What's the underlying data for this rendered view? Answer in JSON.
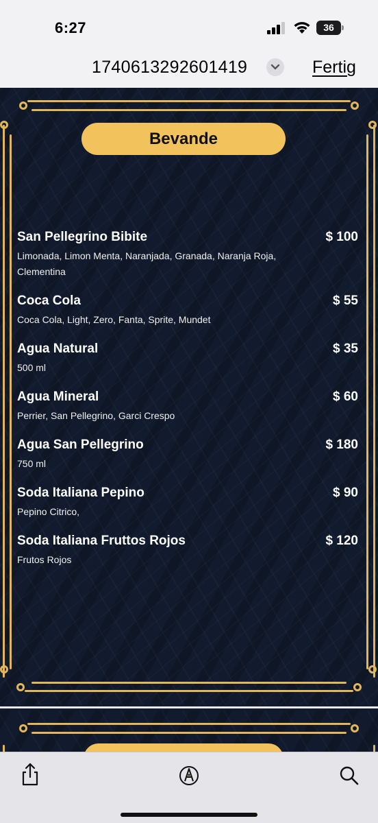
{
  "status_bar": {
    "time": "6:27",
    "battery": "36",
    "icons": [
      "signal-icon",
      "wifi-icon",
      "battery-icon"
    ]
  },
  "nav": {
    "title": "1740613292601419",
    "done_label": "Fertig"
  },
  "menu": {
    "section_title": "Bevande",
    "items": [
      {
        "name": "San Pellegrino Bibite",
        "price": "$ 100",
        "description": "Limonada, Limon Menta, Naranjada, Granada, Naranja Roja, Clementina"
      },
      {
        "name": "Coca Cola",
        "price": "$ 55",
        "description": "Coca Cola, Light, Zero, Fanta, Sprite, Mundet"
      },
      {
        "name": "Agua Natural",
        "price": "$ 35",
        "description": "500 ml"
      },
      {
        "name": "Agua Mineral",
        "price": "$ 60",
        "description": "Perrier, San Pellegrino, Garci Crespo"
      },
      {
        "name": "Agua San Pellegrino",
        "price": "$ 180",
        "description": "750 ml"
      },
      {
        "name": "Soda Italiana Pepino",
        "price": "$ 90",
        "description": "Pepino Citrico,"
      },
      {
        "name": "Soda Italiana Fruttos Rojos",
        "price": "$ 120",
        "description": "Frutos Rojos"
      }
    ]
  },
  "toolbar": {
    "buttons": [
      "share-icon",
      "markup-icon",
      "search-icon"
    ]
  },
  "colors": {
    "menu_background": "#121b2e",
    "gold": "#e2b75a",
    "pill": "#f2c25d"
  }
}
